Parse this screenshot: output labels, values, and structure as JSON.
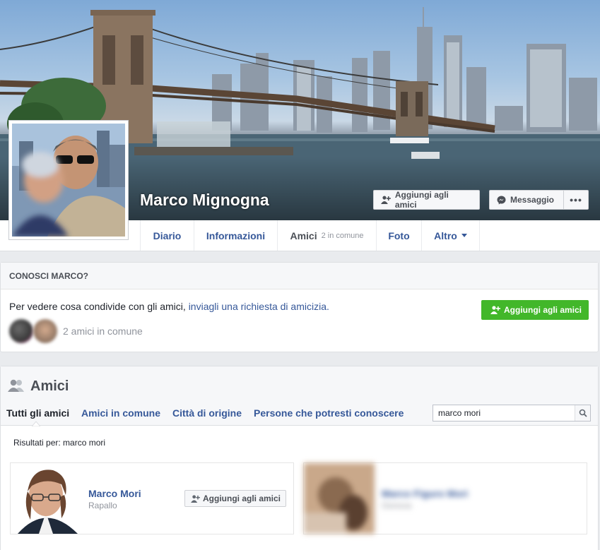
{
  "profile": {
    "name": "Marco Mignogna",
    "add_friend_label": "Aggiungi agli amici",
    "message_label": "Messaggio",
    "more_label": "•••"
  },
  "nav": {
    "tabs": [
      {
        "label": "Diario"
      },
      {
        "label": "Informazioni"
      },
      {
        "label": "Amici",
        "sub": "2 in comune"
      },
      {
        "label": "Foto"
      },
      {
        "label": "Altro"
      }
    ]
  },
  "know": {
    "header": "CONOSCI MARCO?",
    "text": "Per vedere cosa condivide con gli amici, ",
    "link": "inviagli una richiesta di amicizia.",
    "button": "Aggiungi agli amici",
    "mutual": "2 amici in comune"
  },
  "friends": {
    "title": "Amici",
    "tabs": [
      "Tutti gli amici",
      "Amici in comune",
      "Città di origine",
      "Persone che potresti conoscere"
    ],
    "search_value": "marco mori",
    "results_label": "Risultati per: marco mori",
    "results": [
      {
        "name": "Marco Mori",
        "city": "Rapallo",
        "button": "Aggiungi agli amici"
      },
      {
        "name": "Marco Figuro Mori",
        "city": "Genova"
      }
    ]
  },
  "colors": {
    "link": "#365899",
    "green": "#42b72a",
    "bg": "#e9ebee"
  }
}
